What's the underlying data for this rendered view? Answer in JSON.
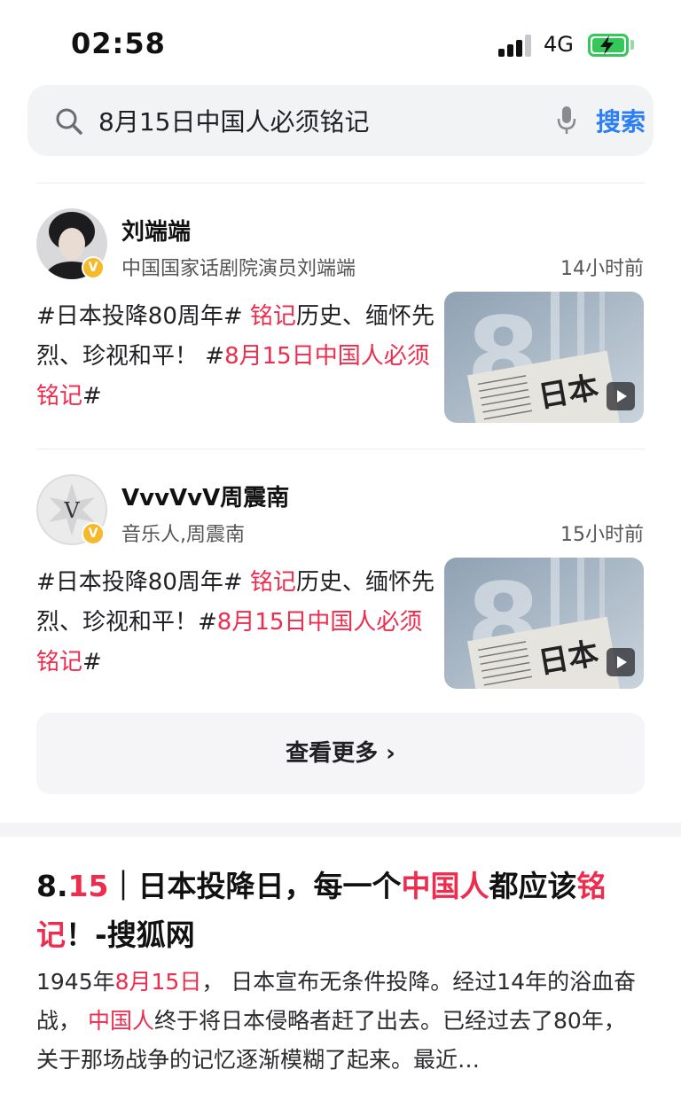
{
  "status_bar": {
    "time": "02:58",
    "network": "4G"
  },
  "search": {
    "query": "8月15日中国人必须铭记",
    "button": "搜索"
  },
  "posts": [
    {
      "author": "刘端端",
      "description": "中国国家话剧院演员刘端端",
      "time": "14小时前",
      "text": [
        {
          "t": " #日本投降80周年# ",
          "hl": false
        },
        {
          "t": "铭记",
          "hl": true
        },
        {
          "t": "历史、缅怀先烈、珍视和平！ #",
          "hl": false
        },
        {
          "t": "8月15日中国人必须铭记",
          "hl": true
        },
        {
          "t": "#",
          "hl": false
        }
      ]
    },
    {
      "author": "VvvVvV周震南",
      "description": "音乐人,周震南",
      "time": "15小时前",
      "text": [
        {
          "t": "#日本投降80周年# ",
          "hl": false
        },
        {
          "t": "铭记",
          "hl": true
        },
        {
          "t": "历史、缅怀先烈、珍视和平！#",
          "hl": false
        },
        {
          "t": "8月15日中国人必须铭记",
          "hl": true
        },
        {
          "t": "#",
          "hl": false
        }
      ]
    }
  ],
  "see_more": "查看更多 ›",
  "article": {
    "title": [
      {
        "t": "8.",
        "hl": false
      },
      {
        "t": "15",
        "hl": true
      },
      {
        "t": "｜日本投降日，每一个",
        "hl": false
      },
      {
        "t": "中国人",
        "hl": true
      },
      {
        "t": "都应该",
        "hl": false
      },
      {
        "t": "铭记",
        "hl": true
      },
      {
        "t": "！-搜狐网",
        "hl": false
      }
    ],
    "snippet": [
      {
        "t": "1945年",
        "hl": false
      },
      {
        "t": "8月15日",
        "hl": true
      },
      {
        "t": "， 日本宣布无条件投降。经过14年的浴血奋战， ",
        "hl": false
      },
      {
        "t": "中国人",
        "hl": true
      },
      {
        "t": "终于将日本侵略者赶了出去。已经过去了80年， 关于那场战争的记忆逐渐模糊了起来。最近…",
        "hl": false
      }
    ]
  },
  "colors": {
    "highlight": "#ee2c4d",
    "accent": "#2b7ef5",
    "verified": "#f5b92a",
    "battery": "#34c759"
  },
  "icons": [
    "search-icon",
    "mic-icon",
    "verified-icon",
    "play-icon",
    "signal-icon",
    "battery-icon"
  ]
}
